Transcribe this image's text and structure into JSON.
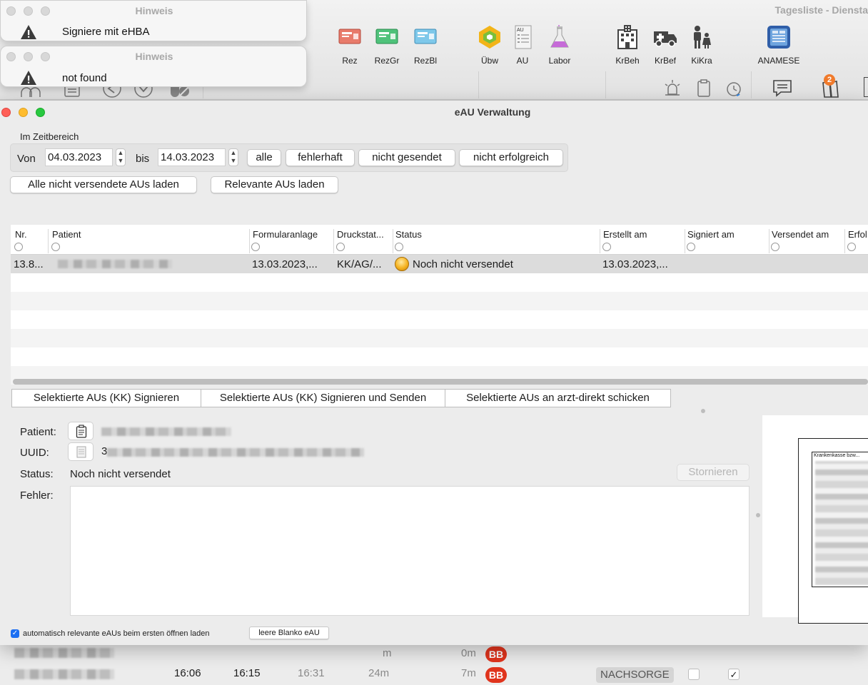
{
  "background_app": {
    "title": "Tagesliste - Diensta",
    "toolbar": [
      {
        "label": "Rez",
        "icon": "prescription-red-icon"
      },
      {
        "label": "RezGr",
        "icon": "prescription-green-icon"
      },
      {
        "label": "RezBl",
        "icon": "prescription-blue-icon"
      },
      {
        "label": "Übw",
        "icon": "referral-icon"
      },
      {
        "label": "AU",
        "icon": "au-form-icon"
      },
      {
        "label": "Labor",
        "icon": "flask-icon"
      },
      {
        "label": "KrBeh",
        "icon": "hospital-icon"
      },
      {
        "label": "KrBef",
        "icon": "ambulance-icon"
      },
      {
        "label": "KiKra",
        "icon": "child-icon"
      },
      {
        "label": "ANAMESE",
        "icon": "anamnese-icon"
      }
    ],
    "au_icon_text": "AU",
    "badge_count": "2",
    "bottom_rows": [
      {
        "col_a": "",
        "col_b": "",
        "col_c": "",
        "col_d": "m",
        "col_e": "0m",
        "badge": "BB",
        "tag": ""
      },
      {
        "col_a": "16:06",
        "col_b": "16:15",
        "col_c": "16:31",
        "col_d": "24m",
        "col_e": "7m",
        "badge": "BB",
        "tag": "NACHSORGE"
      }
    ],
    "check_mark": "✓"
  },
  "notifications": [
    {
      "title": "Hinweis",
      "message": "Signiere mit eHBA"
    },
    {
      "title": "Hinweis",
      "message": "not found"
    }
  ],
  "dialog": {
    "title": "eAU Verwaltung",
    "range_label": "Im Zeitbereich",
    "from_label": "Von",
    "from_date": "04.03.2023",
    "to_label": "bis",
    "to_date": "14.03.2023",
    "filter_buttons": [
      "alle",
      "fehlerhaft",
      "nicht gesendet",
      "nicht erfolgreich"
    ],
    "load_buttons": [
      "Alle nicht versendete AUs laden",
      "Relevante AUs laden"
    ],
    "columns": [
      "Nr.",
      "Patient",
      "Formularanlage",
      "Druckstat...",
      "Status",
      "Erstellt am",
      "Signiert am",
      "Versendet am",
      "Erfol"
    ],
    "rows": [
      {
        "nr": "13.8...",
        "formularanlage": "13.03.2023,...",
        "druckstatus": "KK/AG/...",
        "status": "Noch nicht versendet",
        "erstellt": "13.03.2023,...",
        "signiert": "",
        "versendet": ""
      }
    ],
    "action_buttons": [
      "Selektierte AUs (KK) Signieren",
      "Selektierte AUs (KK) Signieren und Senden",
      "Selektierte AUs an arzt-direkt schicken"
    ],
    "detail": {
      "patient_label": "Patient:",
      "uuid_label": "UUID:",
      "uuid_prefix": "3",
      "status_label": "Status:",
      "status_value": "Noch nicht versendet",
      "error_label": "Fehler:",
      "storno_button": "Stornieren"
    },
    "preview_header": "Krankenkasse bzw...",
    "auto_load_checkbox": "automatisch relevante eAUs beim ersten öffnen laden",
    "blank_button": "leere Blanko eAU",
    "colors": {
      "accent": "#1c6ff2",
      "badge": "#e0341d",
      "status_dot": "#f5b21f"
    }
  }
}
